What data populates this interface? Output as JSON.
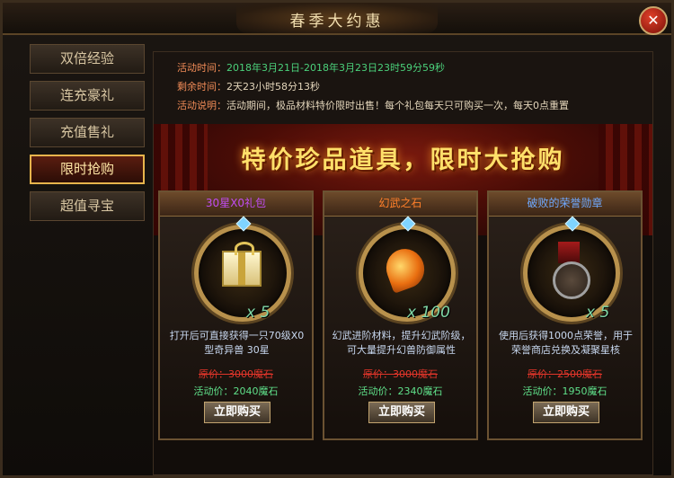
{
  "window": {
    "title": "春季大约惠",
    "close_glyph": "✕"
  },
  "sidebar": {
    "items": [
      {
        "label": "双倍经验",
        "active": false
      },
      {
        "label": "连充豪礼",
        "active": false
      },
      {
        "label": "充值售礼",
        "active": false
      },
      {
        "label": "限时抢购",
        "active": true
      },
      {
        "label": "超值寻宝",
        "active": false
      }
    ]
  },
  "info": {
    "time_label": "活动时间：",
    "time_value": "2018年3月21日-2018年3月23日23时59分59秒",
    "remain_label": "剩余时间：",
    "remain_value": "2天23小时58分13秒",
    "desc_label": "活动说明：",
    "desc_value": "活动期间，极品材料特价限时出售！每个礼包每天只可购买一次，每天0点重置"
  },
  "banner": {
    "text": "特价珍品道具，限时大抢购"
  },
  "cards": [
    {
      "name": "30星X0礼包",
      "name_color": "purple",
      "icon": "gift-icon",
      "qty": "x 5",
      "desc": "打开后可直接获得一只70级X0型奇异兽 30星",
      "orig": "原价：3000魔石",
      "price": "活动价：2040魔石",
      "buy": "立即购买"
    },
    {
      "name": "幻武之石",
      "name_color": "orange",
      "icon": "stone-icon",
      "qty": "x 100",
      "desc": "幻武进阶材料，提升幻武阶级，可大量提升幻兽防御属性",
      "orig": "原价：3000魔石",
      "price": "活动价：2340魔石",
      "buy": "立即购买"
    },
    {
      "name": "破败的荣誉勋章",
      "name_color": "blue",
      "icon": "medal-icon",
      "qty": "x 5",
      "desc": "使用后获得1000点荣誉，用于荣誉商店兑换及凝聚星核",
      "orig": "原价：2500魔石",
      "price": "活动价：1950魔石",
      "buy": "立即购买"
    }
  ]
}
